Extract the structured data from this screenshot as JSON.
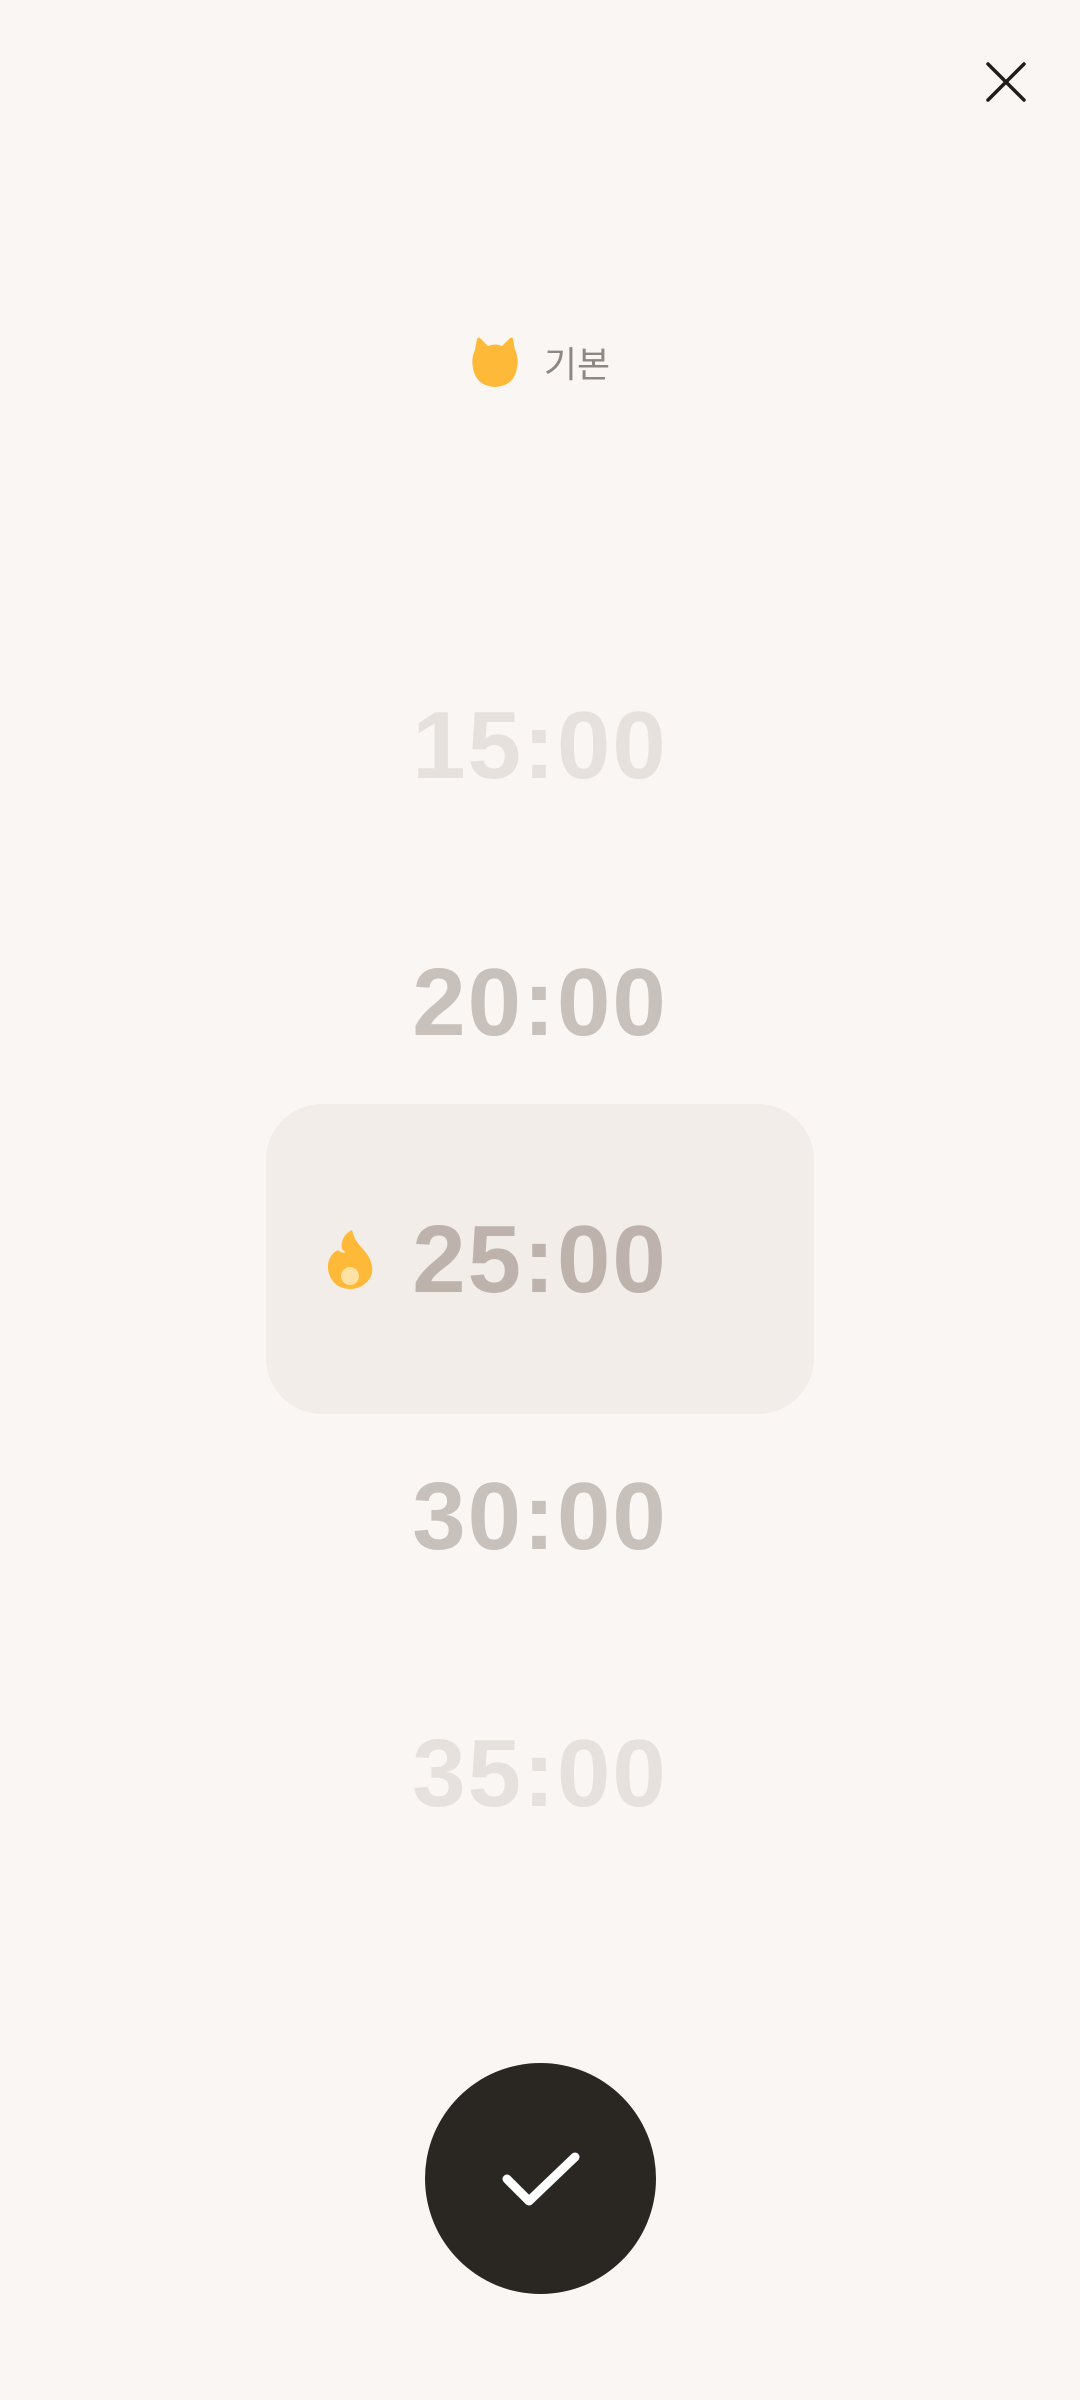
{
  "header": {
    "close_icon": "close-icon"
  },
  "mode": {
    "icon": "cat-icon",
    "icon_color": "#ffb938",
    "label": "기본"
  },
  "timer_picker": {
    "options": [
      "15:00",
      "20:00",
      "25:00",
      "30:00",
      "35:00"
    ],
    "selected": "25:00",
    "selected_icon": "flame-icon",
    "selected_icon_color": "#ffb938"
  },
  "confirm": {
    "icon": "checkmark-icon",
    "background": "#2a2622"
  },
  "colors": {
    "background": "#f9f6f3",
    "text_faded": "#e6e1dd",
    "text_muted": "#c8c0ba",
    "text_selected": "#bdb3ac"
  }
}
